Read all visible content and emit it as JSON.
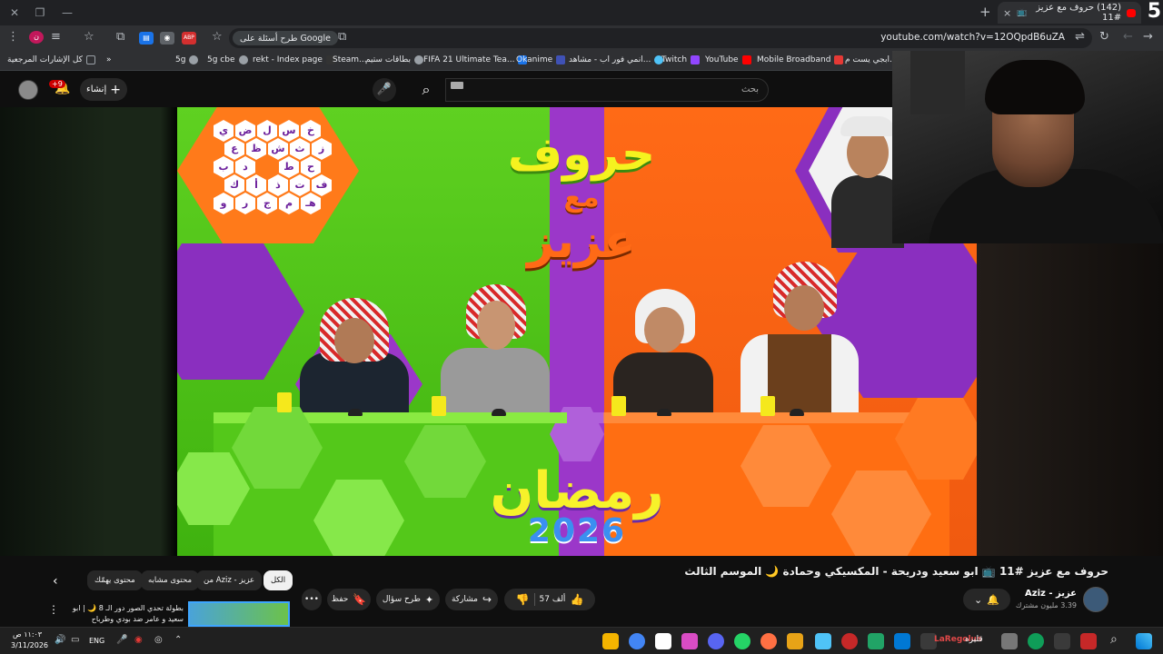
{
  "browser": {
    "tab_title": "(142) حروف مع عزيز #11",
    "tab_close": "×",
    "new_tab": "+",
    "url": "youtube.com/watch?v=12OQpdB6uZA",
    "google_chip": "طرح أسئلة على Google",
    "stream_number": "5"
  },
  "bookmarks": [
    {
      "label": "كل الإشارات المرجعية",
      "color": "#9aa0a6"
    },
    {
      "label": "5g",
      "color": "#9aa0a6"
    },
    {
      "label": "5g cbe",
      "color": "#9aa0a6"
    },
    {
      "label": "rekt - Index page",
      "color": "#9aa0a6"
    },
    {
      "label": "Steam...",
      "color": "#1b2838"
    },
    {
      "label": "بطاقات ستيم",
      "color": "#9aa0a6"
    },
    {
      "label": "FIFA 21 Ultimate Tea...",
      "color": "#1a73e8"
    },
    {
      "label": "Okanime",
      "color": "#3f51b5"
    },
    {
      "label": "انمي فور اب - مشاهد...",
      "color": "#4fc3f7"
    },
    {
      "label": "Twitch",
      "color": "#9146ff"
    },
    {
      "label": "YouTube",
      "color": "#ff0000"
    },
    {
      "label": "Mobile Broadband",
      "color": "#e53935"
    },
    {
      "label": "ابجي يست م...",
      "color": "#9aa0a6"
    }
  ],
  "youtube_header": {
    "search_placeholder": "بحث",
    "create_label": "إنشاء",
    "notification_count": "+9"
  },
  "video": {
    "board_letters": [
      "خ",
      "س",
      "ل",
      "ض",
      "ي",
      "ز",
      "ث",
      "ش",
      "ظ",
      "ع",
      "ح",
      "د",
      "ط",
      "ب",
      "ك",
      "أ",
      "ذ",
      "ت",
      "ف",
      "هـ",
      "م",
      "ج",
      "ر",
      "و"
    ],
    "show_logo_line1": "حروف",
    "show_logo_line2": "مع",
    "show_logo_line3": "عزيز",
    "ramadan_text": "رمضان",
    "year_text": "2026"
  },
  "below_video": {
    "title": "حروف مع عزيز #11 📺 ابو سعيد ودريحة - المكسيكي وحمادة 🌙 الموسم الثالث",
    "channel_name": "عزيز - Aziz",
    "subscribers": "3.39 مليون مشترك",
    "likes": "57 ألف",
    "share_label": "مشاركة",
    "ask_label": "طرح سؤال",
    "save_label": "حفظ",
    "more_label": "•••",
    "chips": [
      "الكل",
      "من Aziz - عزيز",
      "محتوى مشابه",
      "محتوى يهمّك"
    ],
    "rec_title": "بطولة تحدي الصور دور الـ 8 🌙 | ابو سعيد و عامر ضد بودي وطرباح"
  },
  "taskbar": {
    "time": "١١:٠٣ ص",
    "date": "3/11/2026",
    "lang": "ENG",
    "watermark": "LaRegolus",
    "watermark_label": "قليره"
  }
}
